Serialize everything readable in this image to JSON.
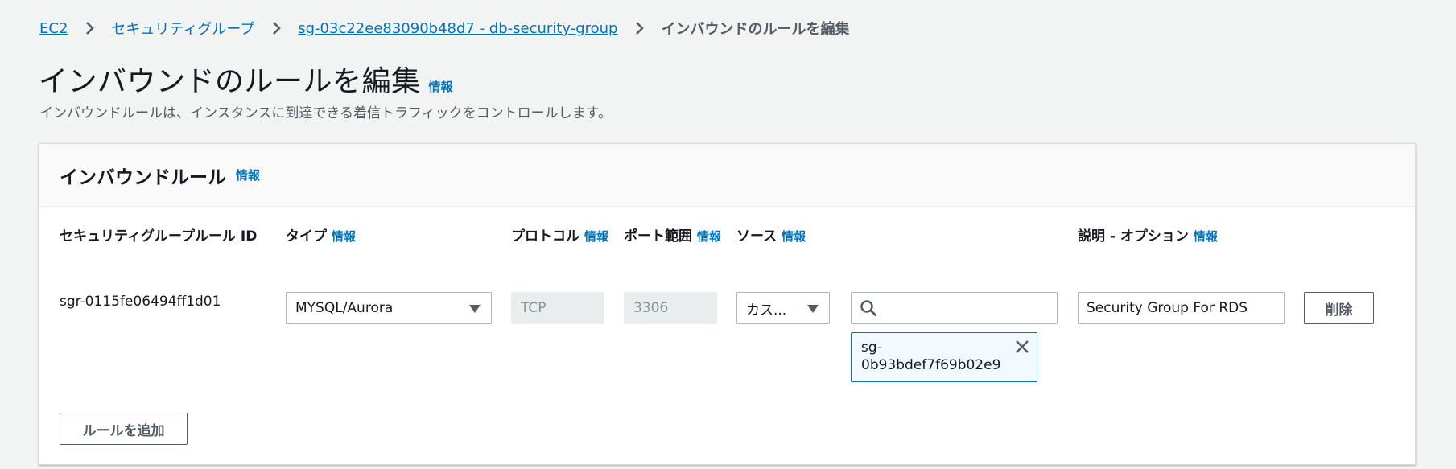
{
  "breadcrumb": {
    "items": [
      "EC2",
      "セキュリティグループ",
      "sg-03c22ee83090b48d7 - db-security-group"
    ],
    "current": "インバウンドのルールを編集"
  },
  "page": {
    "title": "インバウンドのルールを編集",
    "info": "情報",
    "description": "インバウンドルールは、インスタンスに到達できる着信トラフィックをコントロールします。"
  },
  "panel": {
    "title": "インバウンドルール",
    "info": "情報",
    "columns": {
      "rule_id": "セキュリティグループルール ID",
      "type": "タイプ",
      "protocol": "プロトコル",
      "port": "ポート範囲",
      "source": "ソース",
      "description": "説明 - オプション"
    },
    "row": {
      "rule_id": "sgr-0115fe06494ff1d01",
      "type": "MYSQL/Aurora",
      "protocol": "TCP",
      "port": "3306",
      "source_type": "カス...",
      "source_search_value": "",
      "source_token_line1": "sg-",
      "source_token_line2": "0b93bdef7f69b02e9",
      "description": "Security Group For RDS",
      "delete_label": "削除"
    },
    "add_rule_label": "ルールを追加"
  },
  "colors": {
    "link": "#0073bb",
    "page_bg": "#f2f3f3",
    "token_bg": "#f1faff"
  },
  "icons": {
    "breadcrumb_separator": "chevron-right-icon",
    "select_caret": "caret-down-icon",
    "search": "search-icon",
    "token_remove": "close-icon"
  }
}
